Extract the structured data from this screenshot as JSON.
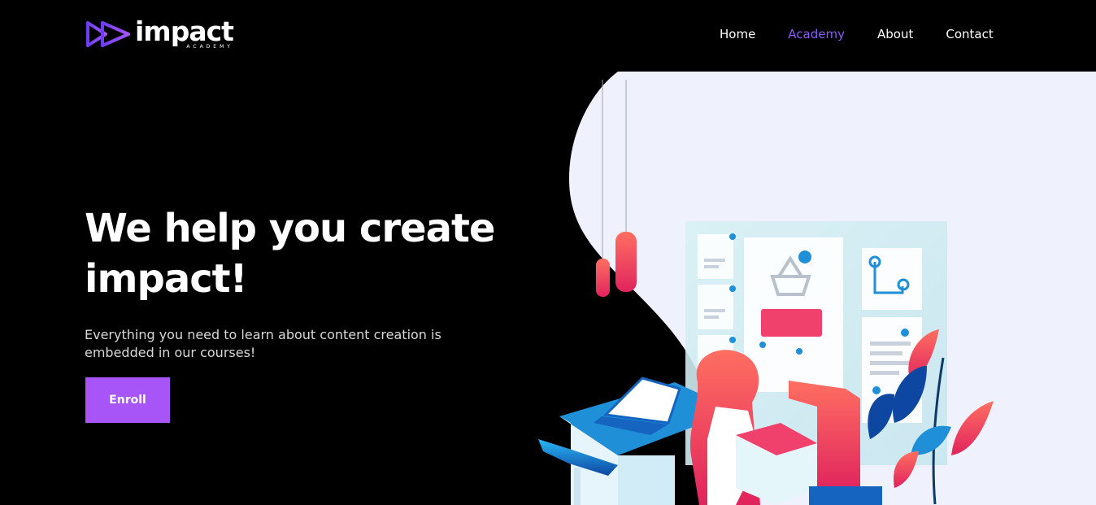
{
  "brand": {
    "name": "impact",
    "subtitle": "ACADEMY",
    "logo_icon": "play-arrows-icon",
    "gradient_start": "#6d3df5",
    "gradient_end": "#a855f7"
  },
  "nav": {
    "items": [
      {
        "label": "Home",
        "active": false
      },
      {
        "label": "Academy",
        "active": true
      },
      {
        "label": "About",
        "active": false
      },
      {
        "label": "Contact",
        "active": false
      }
    ],
    "active_color": "#8b5cf6"
  },
  "hero": {
    "title_line1": "We help you create",
    "title_line2": "impact!",
    "subtitle_line1": "Everything you need to learn about content creation is",
    "subtitle_line2": "embedded in our courses!",
    "cta_label": "Enroll",
    "cta_color": "#a855f7"
  },
  "illustration": {
    "description_icon": "online-shopping-illustration",
    "bg_color": "#eff1fc",
    "accent_pink": "#f0416c",
    "accent_blue": "#1f8fd8"
  }
}
